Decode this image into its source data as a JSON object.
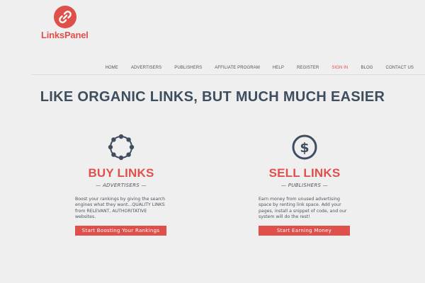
{
  "brand": {
    "name": "LinksPanel",
    "color": "#e0504b",
    "logo_icon": "link-icon"
  },
  "nav": {
    "items": [
      {
        "label": "HOME"
      },
      {
        "label": "ADVERTISERS"
      },
      {
        "label": "PUBLISHERS"
      },
      {
        "label": "AFFILIATE PROGRAM"
      },
      {
        "label": "HELP"
      },
      {
        "label": "REGISTER"
      },
      {
        "label": "SIGN IN",
        "active": true
      },
      {
        "label": "BLOG"
      },
      {
        "label": "CONTACT US"
      }
    ]
  },
  "hero": {
    "title": "LIKE ORGANIC LINKS, BUT MUCH MUCH EASIER"
  },
  "buy": {
    "icon": "network-circle-icon",
    "title": "BUY LINKS",
    "subtitle": "— ADVERTISERS —",
    "description": "Boost your rankings by giving the search engines what they want...QUALITY LINKS from RELEVANT, AUTHORITATIVE websites.",
    "button": "Start Boosting Your Rankings"
  },
  "sell": {
    "icon": "dollar-circle-icon",
    "title": "SELL LINKS",
    "subtitle": "— PUBLISHERS —",
    "description": "Earn money from unused advertising space by renting link space. Add your pages, install a snippet of code, and our system will do the rest!",
    "button": "Start Earning Money"
  }
}
